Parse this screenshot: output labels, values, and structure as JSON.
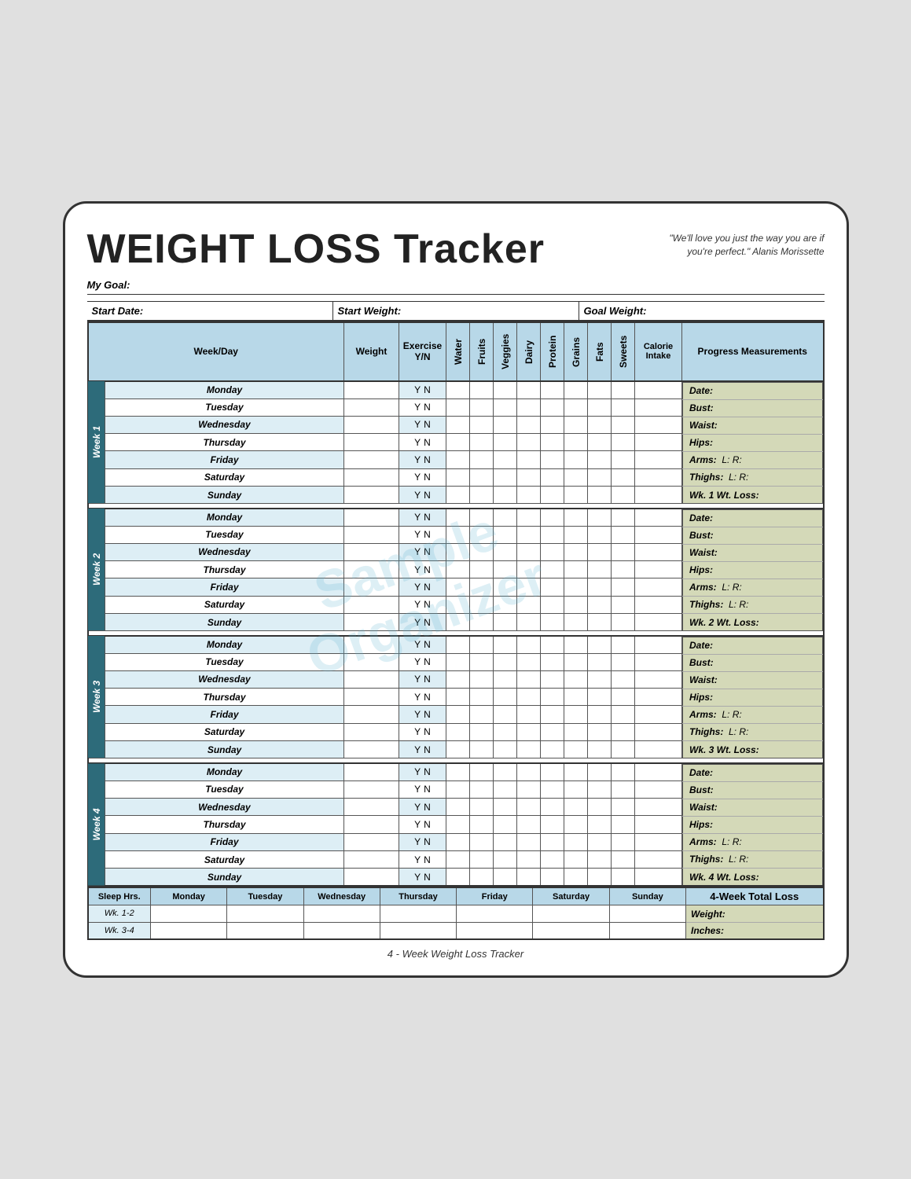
{
  "title": "WEIGHT LOSS Tracker",
  "quote": "\"We'll love you just the way you are if you're perfect.\"  Alanis Morissette",
  "my_goal_label": "My Goal:",
  "start_date_label": "Start Date:",
  "start_weight_label": "Start Weight:",
  "goal_weight_label": "Goal Weight:",
  "col_headers": {
    "week_day": "Week/Day",
    "weight": "Weight",
    "exercise": "Exercise Y/N",
    "water": "Water",
    "fruits": "Fruits",
    "veggies": "Veggies",
    "dairy": "Dairy",
    "protein": "Protein",
    "grains": "Grains",
    "fats": "Fats",
    "sweets": "Sweets",
    "calorie": "Calorie Intake",
    "progress": "Progress Measurements"
  },
  "weeks": [
    {
      "label": "Week 1",
      "days": [
        "Monday",
        "Tuesday",
        "Wednesday",
        "Thursday",
        "Friday",
        "Saturday",
        "Sunday"
      ],
      "progress": {
        "date": "Date:",
        "bust": "Bust:",
        "waist": "Waist:",
        "hips": "Hips:",
        "arms": "Arms:",
        "arms_l": "L:",
        "arms_r": "R:",
        "thighs": "Thighs:",
        "thighs_l": "L:",
        "thighs_r": "R:",
        "wt_loss": "Wk. 1 Wt. Loss:"
      }
    },
    {
      "label": "Week 2",
      "days": [
        "Monday",
        "Tuesday",
        "Wednesday",
        "Thursday",
        "Friday",
        "Saturday",
        "Sunday"
      ],
      "progress": {
        "date": "Date:",
        "bust": "Bust:",
        "waist": "Waist:",
        "hips": "Hips:",
        "arms": "Arms:",
        "arms_l": "L:",
        "arms_r": "R:",
        "thighs": "Thighs:",
        "thighs_l": "L:",
        "thighs_r": "R:",
        "wt_loss": "Wk. 2 Wt. Loss:"
      }
    },
    {
      "label": "Week 3",
      "days": [
        "Monday",
        "Tuesday",
        "Wednesday",
        "Thursday",
        "Friday",
        "Saturday",
        "Sunday"
      ],
      "progress": {
        "date": "Date:",
        "bust": "Bust:",
        "waist": "Waist:",
        "hips": "Hips:",
        "arms": "Arms:",
        "arms_l": "L:",
        "arms_r": "R:",
        "thighs": "Thighs:",
        "thighs_l": "L:",
        "thighs_r": "R:",
        "wt_loss": "Wk. 3 Wt. Loss:"
      }
    },
    {
      "label": "Week 4",
      "days": [
        "Monday",
        "Tuesday",
        "Wednesday",
        "Thursday",
        "Friday",
        "Saturday",
        "Sunday"
      ],
      "progress": {
        "date": "Date:",
        "bust": "Bust:",
        "waist": "Waist:",
        "hips": "Hips:",
        "arms": "Arms:",
        "arms_l": "L:",
        "arms_r": "R:",
        "thighs": "Thighs:",
        "thighs_l": "L:",
        "thighs_r": "R:",
        "wt_loss": "Wk. 4 Wt. Loss:"
      }
    }
  ],
  "sleep_section": {
    "sleep_hrs": "Sleep Hrs.",
    "days": [
      "Monday",
      "Tuesday",
      "Wednesday",
      "Thursday",
      "Friday",
      "Saturday",
      "Sunday"
    ],
    "rows": [
      "Wk. 1-2",
      "Wk. 3-4"
    ]
  },
  "total_loss": {
    "header": "4-Week Total Loss",
    "weight": "Weight:",
    "inches": "Inches:"
  },
  "footer": "4 - Week Weight Loss Tracker",
  "watermark_line1": "Sample",
  "watermark_line2": "Organizer"
}
